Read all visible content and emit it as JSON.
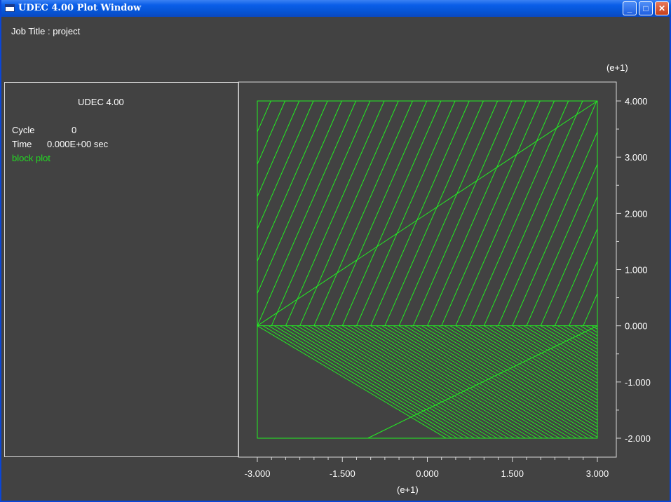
{
  "window": {
    "title": "UDEC 4.00 Plot Window",
    "controls": {
      "minimize": "_",
      "maximize": "□",
      "close": "✕"
    }
  },
  "job_title": "Job Title : project",
  "legend": {
    "program": "UDEC 4.00",
    "cycle_label": "Cycle",
    "cycle_value": "0",
    "time_label": "Time",
    "time_value": "0.000E+00 sec",
    "plot_item": "block plot"
  },
  "colors": {
    "plot_item": "#22dd22",
    "block_lines": "#22ee22",
    "frame": "#d8d8d8",
    "background": "#424242"
  },
  "axes": {
    "y_multiplier": "(e+1)",
    "x_multiplier": "(e+1)",
    "y_tick_labels": [
      "4.000",
      "3.000",
      "2.000",
      "1.000",
      "0.000",
      "-1.000",
      "-2.000"
    ],
    "x_tick_labels": [
      "-3.000",
      "-1.500",
      "0.000",
      "1.500",
      "3.000"
    ]
  },
  "chart_data": {
    "type": "block plot",
    "x_range": [
      -3.0,
      3.0
    ],
    "y_range": [
      -2.0,
      4.0
    ],
    "model_boundary": [
      [
        -3.0,
        -2.0
      ],
      [
        3.0,
        4.0
      ]
    ],
    "horizontal_contact": [
      [
        -3.0,
        0.0
      ],
      [
        3.0,
        0.0
      ]
    ],
    "crossing_joints": [
      {
        "from": [
          -3.0,
          0.0
        ],
        "to": [
          3.0,
          4.0
        ]
      },
      {
        "from": [
          -1.05,
          -2.0
        ],
        "to": [
          3.0,
          0.0
        ]
      }
    ],
    "joint_set_upper": {
      "region": "y >= 0",
      "slope_dy_dx": 2.3,
      "spacing_x": 0.25
    },
    "joint_set_lower": {
      "region": "y <= 0",
      "slope_dy_dx": -0.6,
      "spacing_x": 0.1
    }
  }
}
